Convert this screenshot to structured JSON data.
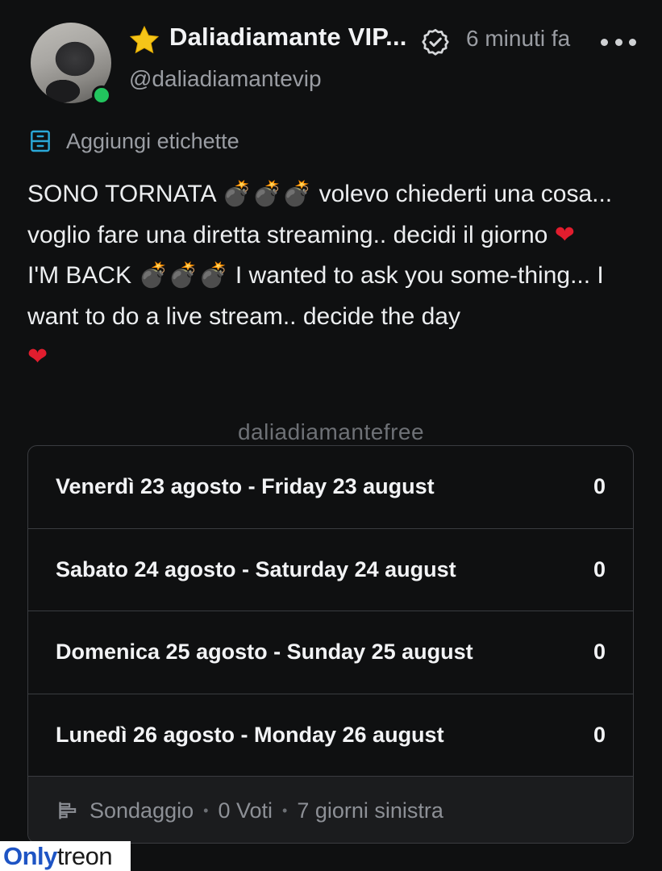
{
  "post": {
    "author": {
      "display_name": "Daliadiamante VIP...",
      "handle": "@daliadiamantevip",
      "online": true,
      "verified": true,
      "star_icon": "star-icon"
    },
    "time_ago": "6 minuti fa",
    "tags_label": "Aggiungi etichette",
    "text": {
      "it_1": "SONO TORNATA",
      "it_2": "volevo chiederti una cosa... voglio fare una diretta streaming.. decidi il giorno",
      "en_1": "I'M BACK",
      "en_2": "I wanted to ask you some-thing... I want to do a live stream.. decide the day"
    },
    "emojis": {
      "bomb": "💣",
      "heart": "❤"
    }
  },
  "watermark_text": "daliadiamantefree",
  "poll": {
    "options": [
      {
        "label": "Venerdì 23 agosto - Friday 23 august",
        "votes": "0"
      },
      {
        "label": "Sabato 24 agosto - Saturday 24 august",
        "votes": "0"
      },
      {
        "label": "Domenica 25 agosto - Sunday 25 august",
        "votes": "0"
      },
      {
        "label": "Lunedì 26 agosto - Monday 26 august",
        "votes": "0"
      }
    ],
    "footer": {
      "type": "Sondaggio",
      "votes": "0 Voti",
      "remaining": "7 giorni sinistra",
      "separator": "•"
    }
  },
  "site_watermark": {
    "part1": "Only",
    "part2": "treon"
  },
  "colors": {
    "background": "#0f1011",
    "text_primary": "#f2f3f5",
    "text_secondary": "#9a9da3",
    "accent_tag": "#2aa8d8",
    "online": "#22c55e",
    "star": "#f5c518",
    "heart": "#e11d2e",
    "poll_border": "#3a3c40",
    "poll_footer_bg": "#1b1c1e"
  }
}
